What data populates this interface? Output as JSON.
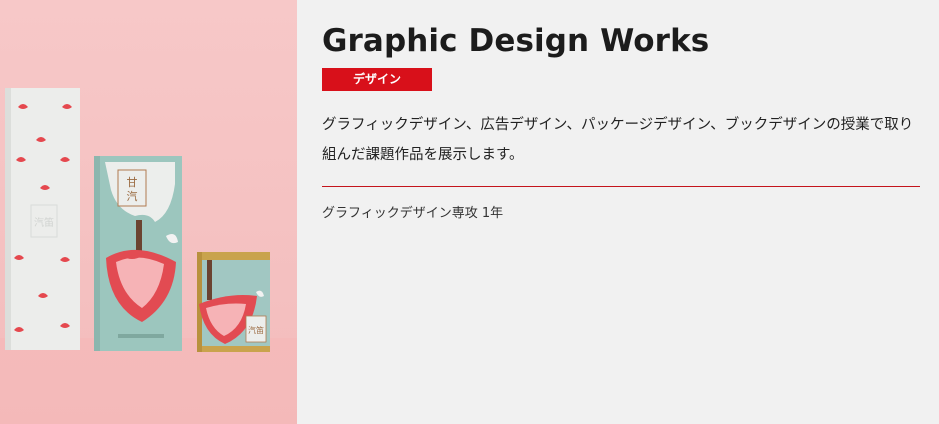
{
  "section": {
    "title": "Graphic Design Works",
    "badge": "デザイン",
    "description": "グラフィックデザイン、広告デザイン、パッケージデザイン、ブックデザインの授業で取り組んだ課題作品を展示します。",
    "meta": "グラフィックデザイン専攻 1年"
  },
  "photo": {
    "package_label": "汽笛 甘い",
    "colors": {
      "background": "#f7c9c9",
      "box_mint": "#9fc8c0",
      "box_white": "#eceeec",
      "strawberry": "#e84a52",
      "accent": "#d8101a"
    }
  }
}
